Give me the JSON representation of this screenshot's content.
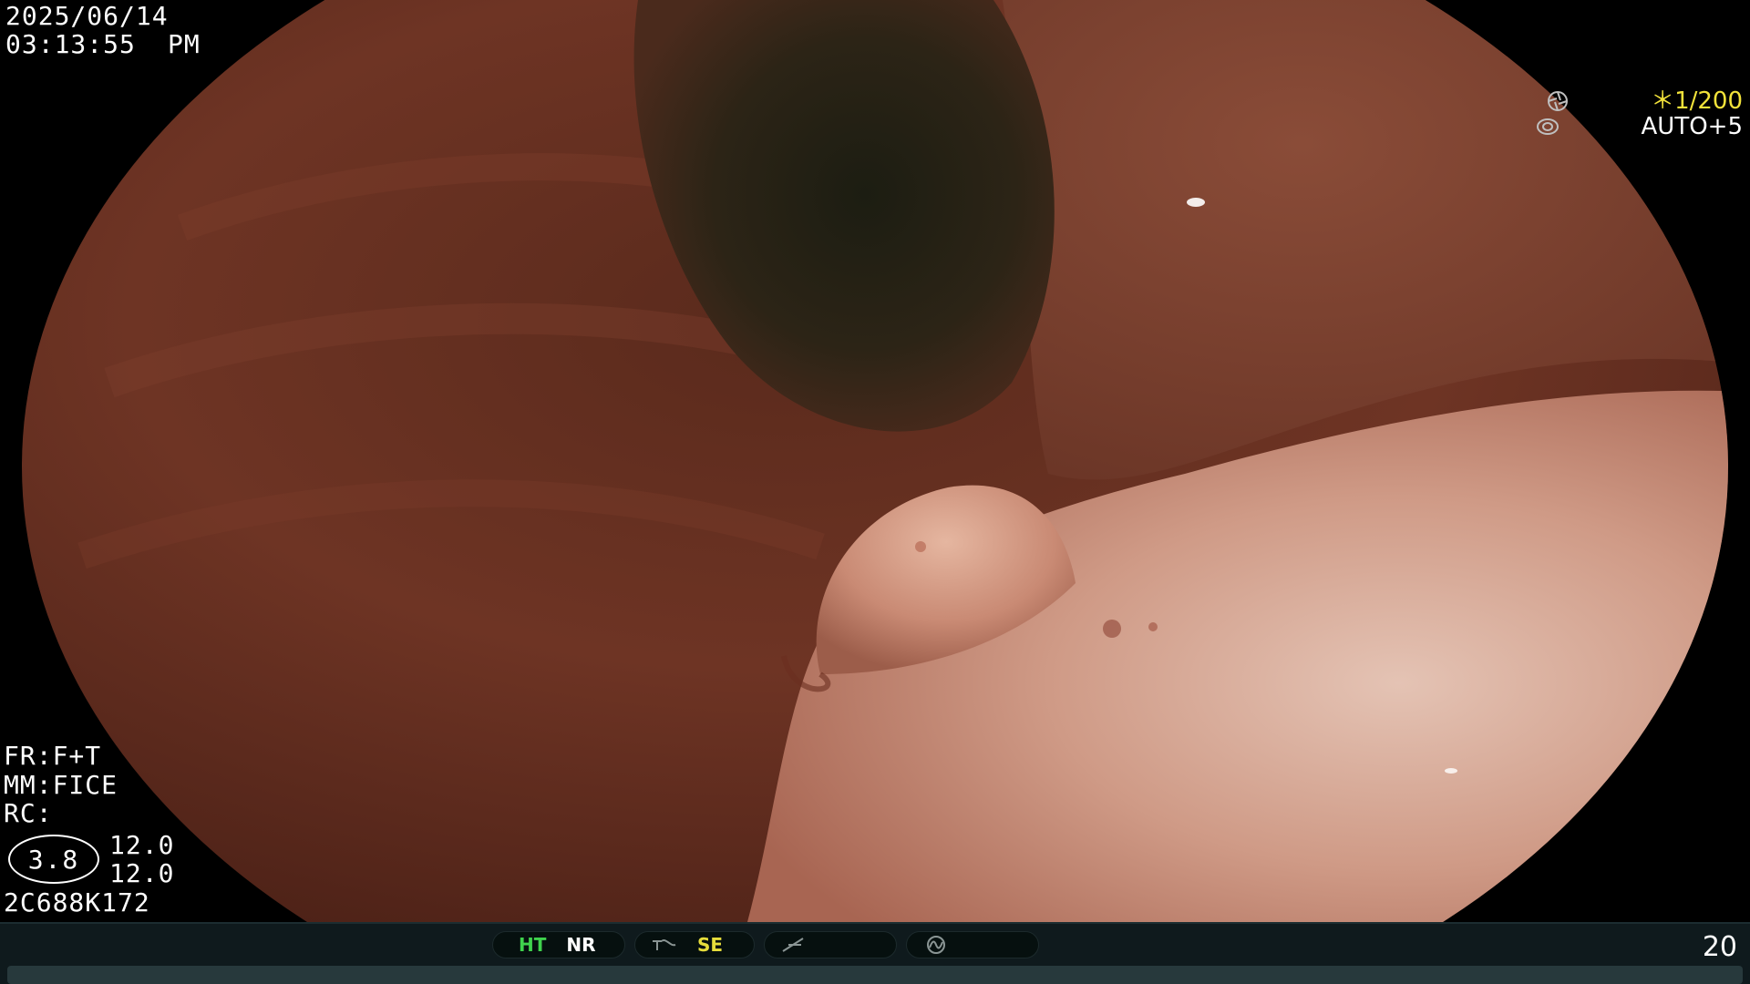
{
  "osd": {
    "date": "2025/06/14",
    "time": "03:13:55",
    "ampm": "PM",
    "shutter": "＊1/200",
    "exposure": "AUTO+5",
    "fr": "FR:F+T",
    "mm": "MM:FICE",
    "rc": "RC:",
    "zoom": "3.8",
    "value_a": "12.0",
    "value_b": "12.0",
    "scope_id": "2C688K172"
  },
  "status_bar": {
    "ht": "HT",
    "nr": "NR",
    "se": "SE",
    "frame_count": "20"
  },
  "icons": {
    "shutter": "aperture-icon",
    "exposure": "iris-icon",
    "structure": "structure-enhance-icon",
    "color": "color-enhance-icon",
    "freeze": "freeze-mode-icon"
  },
  "colors": {
    "accent_yellow": "#f2e23a",
    "ht_green": "#3fd24d",
    "se_yellow": "#e6dd3b",
    "status_bar_bg": "#0f1a1d"
  }
}
